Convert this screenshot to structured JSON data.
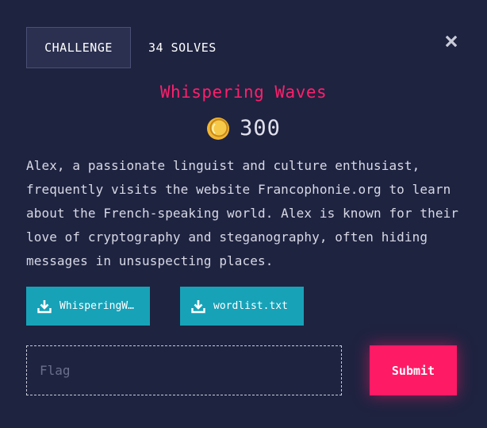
{
  "tabs": {
    "challenge_label": "CHALLENGE",
    "solves_label": "34 SOLVES"
  },
  "close_icon": "close-x-icon",
  "challenge": {
    "title": "Whispering Waves",
    "points": "300",
    "points_icon": "coin-icon",
    "description": "Alex, a passionate linguist and culture enthusiast, frequently visits the website Francophonie.org to learn about the French-speaking world. Alex is known for their love of cryptography and steganography, often hiding messages in unsuspecting places."
  },
  "files": [
    {
      "label": "WhisperingW…",
      "icon": "download-icon"
    },
    {
      "label": "wordlist.txt",
      "icon": "download-icon"
    }
  ],
  "flag": {
    "placeholder": "Flag",
    "value": ""
  },
  "submit_label": "Submit",
  "colors": {
    "background": "#1e2340",
    "accent": "#ff1a66",
    "file_button": "#17a2b8",
    "coin": "#f2b632"
  }
}
